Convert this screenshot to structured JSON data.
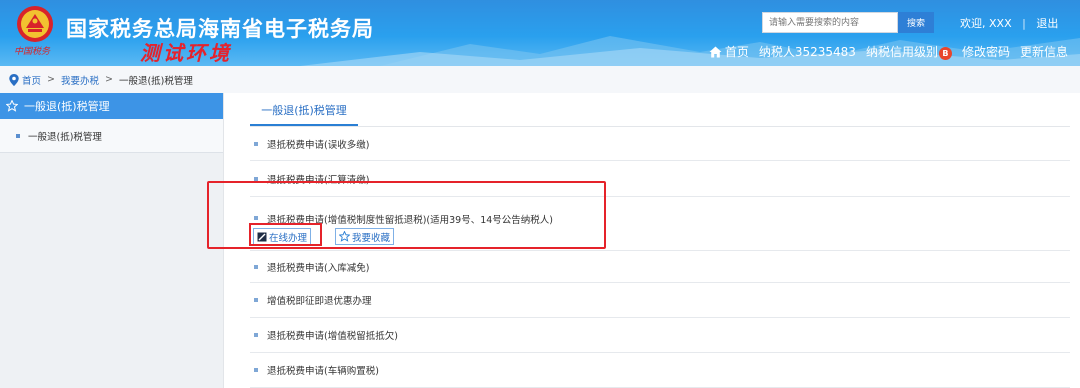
{
  "header": {
    "title": "国家税务总局海南省电子税务局",
    "env_badge": "测试环境",
    "emblem_caption": "中国税务",
    "search": {
      "placeholder": "请输入需要搜索的内容",
      "button": "搜索"
    },
    "welcome": "欢迎,",
    "user": "XXX",
    "separator": "|",
    "logout": "退出",
    "nav": {
      "home": "首页",
      "taxpayer": "纳税人35235483",
      "credit": "纳税信用级别",
      "credit_grade": "B",
      "change_password": "修改密码",
      "update_info": "更新信息"
    }
  },
  "breadcrumb": [
    "首页",
    "我要办税",
    "一般退(抵)税管理"
  ],
  "sidebar": {
    "header": "一般退(抵)税管理",
    "items": [
      {
        "label": "一般退(抵)税管理"
      }
    ]
  },
  "main": {
    "tab": "一般退(抵)税管理",
    "items": [
      {
        "label": "退抵税费申请(误收多缴)"
      },
      {
        "label": "退抵税费申请(汇算清缴)"
      },
      {
        "label": "退抵税费申请(增值税制度性留抵退税)(适用39号、14号公告纳税人)"
      },
      {
        "label": "退抵税费申请(入库减免)"
      },
      {
        "label": "增值税即征即退优惠办理"
      },
      {
        "label": "退抵税费申请(增值税留抵抵欠)"
      },
      {
        "label": "退抵税费申请(车辆购置税)"
      }
    ],
    "actions": {
      "online": "在线办理",
      "favorite": "我要收藏"
    }
  },
  "colors": {
    "header_blue": "#2a9ae9",
    "sidebar_active": "#3d94e6",
    "link": "#2a6fc4",
    "highlight_red": "#e5232a"
  },
  "icons": {
    "emblem": "tax-emblem-icon",
    "home": "home-icon",
    "pin": "location-pin-icon",
    "sidebar": "star-outline-icon",
    "online": "edit-icon",
    "favorite": "star-outline-icon"
  }
}
